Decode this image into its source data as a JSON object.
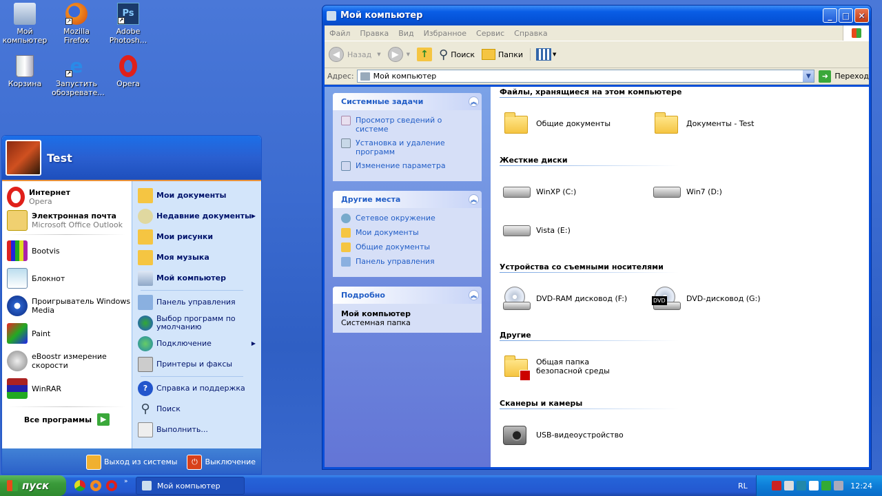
{
  "desktop": {
    "icons": [
      {
        "label": "Мой компьютер",
        "icon": "my-computer-icon"
      },
      {
        "label": "Mozilla Firefox",
        "icon": "firefox-icon"
      },
      {
        "label": "Adobe Photosh...",
        "icon": "photoshop-icon"
      },
      {
        "label": "Корзина",
        "icon": "recycle-bin-icon"
      },
      {
        "label": "Запустить обозревате...",
        "icon": "internet-explorer-icon"
      },
      {
        "label": "Opera",
        "icon": "opera-icon"
      }
    ]
  },
  "window": {
    "title": "Мой компьютер",
    "menu": [
      "Файл",
      "Правка",
      "Вид",
      "Избранное",
      "Сервис",
      "Справка"
    ],
    "toolbar": {
      "back": "Назад",
      "search": "Поиск",
      "folders": "Папки"
    },
    "address": {
      "label": "Адрес:",
      "value": "Мой компьютер",
      "go": "Переход"
    },
    "left_panels": {
      "system_tasks": {
        "title": "Системные задачи",
        "items": [
          "Просмотр сведений о системе",
          "Установка и удаление программ",
          "Изменение параметра"
        ]
      },
      "other_places": {
        "title": "Другие места",
        "items": [
          "Сетевое окружение",
          "Мои документы",
          "Общие документы",
          "Панель управления"
        ]
      },
      "details": {
        "title": "Подробно",
        "name": "Мой компьютер",
        "desc": "Системная папка"
      }
    },
    "sections": {
      "files": {
        "title": "Файлы, хранящиеся на этом компьютере",
        "items": [
          "Общие документы",
          "Документы - Test"
        ]
      },
      "hdd": {
        "title": "Жесткие диски",
        "items": [
          "WinXP (C:)",
          "Win7 (D:)",
          "Vista (E:)"
        ]
      },
      "removable": {
        "title": "Устройства со съемными носителями",
        "items": [
          "DVD-RAM дисковод (F:)",
          "DVD-дисковод (G:)"
        ]
      },
      "other": {
        "title": "Другие",
        "items": [
          "Общая папка безопасной среды"
        ]
      },
      "scanners": {
        "title": "Сканеры и камеры",
        "items": [
          "USB-видеоустройство"
        ]
      }
    }
  },
  "start_menu": {
    "user": "Test",
    "pinned": [
      {
        "title": "Интернет",
        "sub": "Opera"
      },
      {
        "title": "Электронная почта",
        "sub": "Microsoft Office Outlook"
      }
    ],
    "recent": [
      "Bootvis",
      "Блокнот",
      "Проигрыватель Windows Media",
      "Paint",
      "eBoostr измерение скорости",
      "WinRAR"
    ],
    "all_programs": "Все программы",
    "right": {
      "my_docs": "Мои документы",
      "recent_docs": "Недавние документы",
      "my_pics": "Мои рисунки",
      "my_music": "Моя музыка",
      "my_computer": "Мой компьютер",
      "control_panel": "Панель управления",
      "defaults": "Выбор программ по умолчанию",
      "connect": "Подключение",
      "printers": "Принтеры и факсы",
      "help": "Справка и поддержка",
      "search": "Поиск",
      "run": "Выполнить..."
    },
    "logoff": "Выход из системы",
    "shutdown": "Выключение"
  },
  "taskbar": {
    "start": "пуск",
    "task": "Мой компьютер",
    "lang": "RL",
    "clock": "12:24"
  }
}
